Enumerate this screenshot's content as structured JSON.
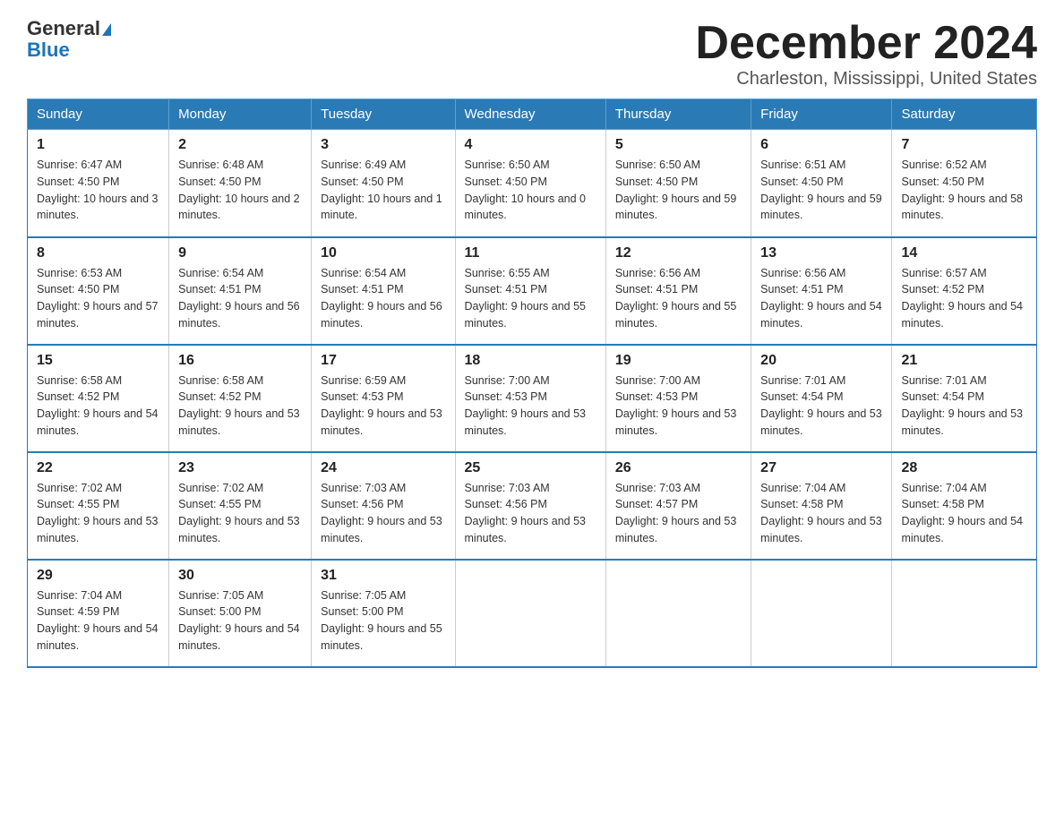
{
  "header": {
    "logo_general": "General",
    "logo_blue": "Blue",
    "month_title": "December 2024",
    "location": "Charleston, Mississippi, United States"
  },
  "days_of_week": [
    "Sunday",
    "Monday",
    "Tuesday",
    "Wednesday",
    "Thursday",
    "Friday",
    "Saturday"
  ],
  "weeks": [
    [
      {
        "day": "1",
        "sunrise": "6:47 AM",
        "sunset": "4:50 PM",
        "daylight": "10 hours and 3 minutes."
      },
      {
        "day": "2",
        "sunrise": "6:48 AM",
        "sunset": "4:50 PM",
        "daylight": "10 hours and 2 minutes."
      },
      {
        "day": "3",
        "sunrise": "6:49 AM",
        "sunset": "4:50 PM",
        "daylight": "10 hours and 1 minute."
      },
      {
        "day": "4",
        "sunrise": "6:50 AM",
        "sunset": "4:50 PM",
        "daylight": "10 hours and 0 minutes."
      },
      {
        "day": "5",
        "sunrise": "6:50 AM",
        "sunset": "4:50 PM",
        "daylight": "9 hours and 59 minutes."
      },
      {
        "day": "6",
        "sunrise": "6:51 AM",
        "sunset": "4:50 PM",
        "daylight": "9 hours and 59 minutes."
      },
      {
        "day": "7",
        "sunrise": "6:52 AM",
        "sunset": "4:50 PM",
        "daylight": "9 hours and 58 minutes."
      }
    ],
    [
      {
        "day": "8",
        "sunrise": "6:53 AM",
        "sunset": "4:50 PM",
        "daylight": "9 hours and 57 minutes."
      },
      {
        "day": "9",
        "sunrise": "6:54 AM",
        "sunset": "4:51 PM",
        "daylight": "9 hours and 56 minutes."
      },
      {
        "day": "10",
        "sunrise": "6:54 AM",
        "sunset": "4:51 PM",
        "daylight": "9 hours and 56 minutes."
      },
      {
        "day": "11",
        "sunrise": "6:55 AM",
        "sunset": "4:51 PM",
        "daylight": "9 hours and 55 minutes."
      },
      {
        "day": "12",
        "sunrise": "6:56 AM",
        "sunset": "4:51 PM",
        "daylight": "9 hours and 55 minutes."
      },
      {
        "day": "13",
        "sunrise": "6:56 AM",
        "sunset": "4:51 PM",
        "daylight": "9 hours and 54 minutes."
      },
      {
        "day": "14",
        "sunrise": "6:57 AM",
        "sunset": "4:52 PM",
        "daylight": "9 hours and 54 minutes."
      }
    ],
    [
      {
        "day": "15",
        "sunrise": "6:58 AM",
        "sunset": "4:52 PM",
        "daylight": "9 hours and 54 minutes."
      },
      {
        "day": "16",
        "sunrise": "6:58 AM",
        "sunset": "4:52 PM",
        "daylight": "9 hours and 53 minutes."
      },
      {
        "day": "17",
        "sunrise": "6:59 AM",
        "sunset": "4:53 PM",
        "daylight": "9 hours and 53 minutes."
      },
      {
        "day": "18",
        "sunrise": "7:00 AM",
        "sunset": "4:53 PM",
        "daylight": "9 hours and 53 minutes."
      },
      {
        "day": "19",
        "sunrise": "7:00 AM",
        "sunset": "4:53 PM",
        "daylight": "9 hours and 53 minutes."
      },
      {
        "day": "20",
        "sunrise": "7:01 AM",
        "sunset": "4:54 PM",
        "daylight": "9 hours and 53 minutes."
      },
      {
        "day": "21",
        "sunrise": "7:01 AM",
        "sunset": "4:54 PM",
        "daylight": "9 hours and 53 minutes."
      }
    ],
    [
      {
        "day": "22",
        "sunrise": "7:02 AM",
        "sunset": "4:55 PM",
        "daylight": "9 hours and 53 minutes."
      },
      {
        "day": "23",
        "sunrise": "7:02 AM",
        "sunset": "4:55 PM",
        "daylight": "9 hours and 53 minutes."
      },
      {
        "day": "24",
        "sunrise": "7:03 AM",
        "sunset": "4:56 PM",
        "daylight": "9 hours and 53 minutes."
      },
      {
        "day": "25",
        "sunrise": "7:03 AM",
        "sunset": "4:56 PM",
        "daylight": "9 hours and 53 minutes."
      },
      {
        "day": "26",
        "sunrise": "7:03 AM",
        "sunset": "4:57 PM",
        "daylight": "9 hours and 53 minutes."
      },
      {
        "day": "27",
        "sunrise": "7:04 AM",
        "sunset": "4:58 PM",
        "daylight": "9 hours and 53 minutes."
      },
      {
        "day": "28",
        "sunrise": "7:04 AM",
        "sunset": "4:58 PM",
        "daylight": "9 hours and 54 minutes."
      }
    ],
    [
      {
        "day": "29",
        "sunrise": "7:04 AM",
        "sunset": "4:59 PM",
        "daylight": "9 hours and 54 minutes."
      },
      {
        "day": "30",
        "sunrise": "7:05 AM",
        "sunset": "5:00 PM",
        "daylight": "9 hours and 54 minutes."
      },
      {
        "day": "31",
        "sunrise": "7:05 AM",
        "sunset": "5:00 PM",
        "daylight": "9 hours and 55 minutes."
      },
      null,
      null,
      null,
      null
    ]
  ]
}
